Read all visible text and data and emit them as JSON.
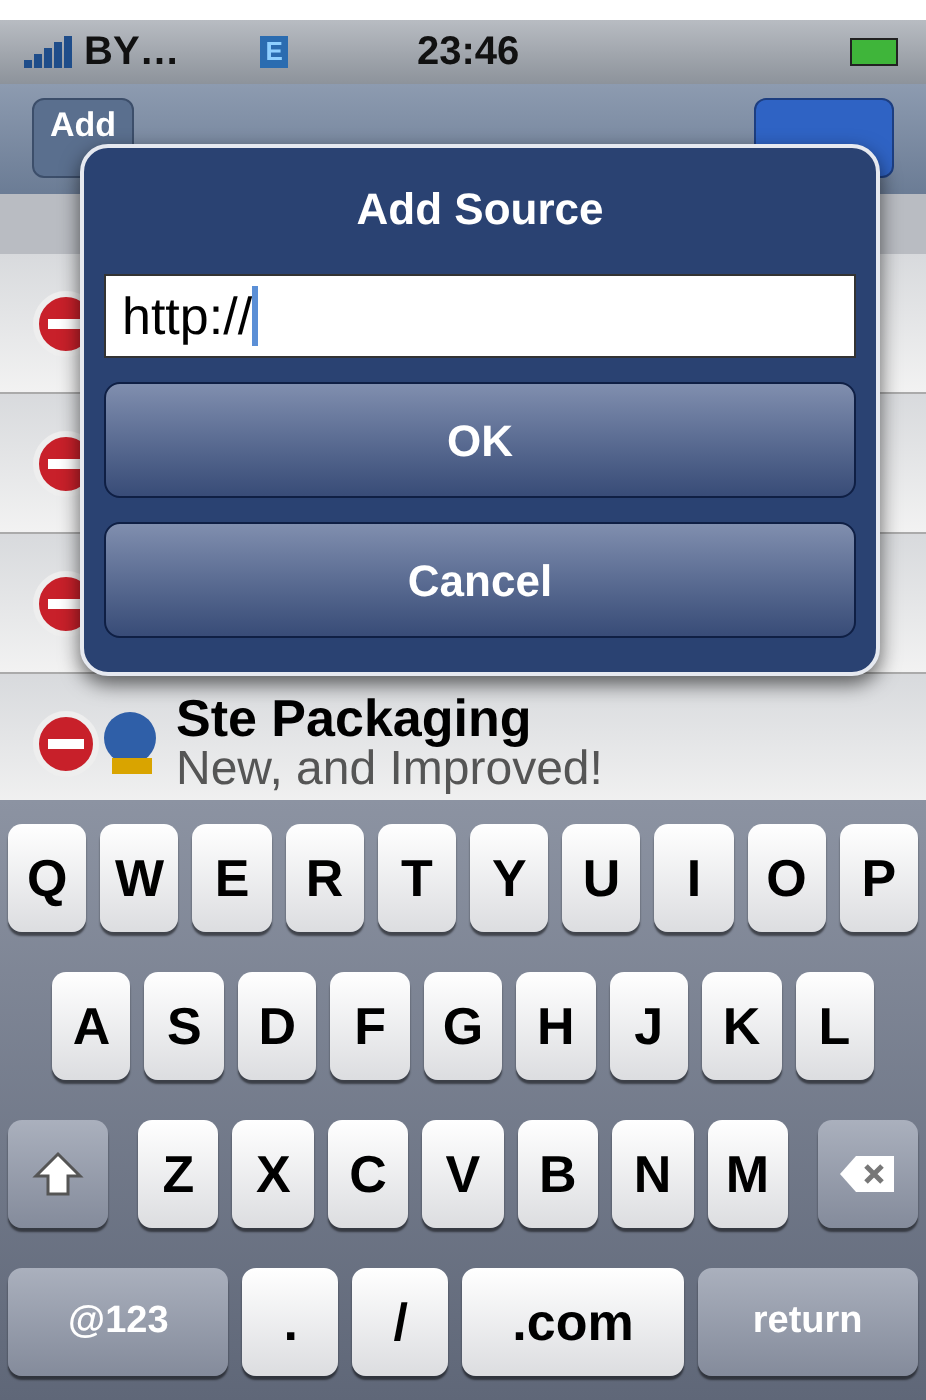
{
  "status_bar": {
    "carrier": "BY…",
    "network": "E",
    "time": "23:46"
  },
  "nav_bar": {
    "left_button": "Add"
  },
  "sources": [
    {
      "deletable": true
    },
    {
      "deletable": true
    },
    {
      "deletable": true
    },
    {
      "deletable": true,
      "name": "Ste Packaging",
      "subtitle": "New, and Improved!"
    }
  ],
  "dialog": {
    "title": "Add Source",
    "field_value": "http://",
    "buttons": [
      "OK",
      "Cancel"
    ]
  },
  "keyboard": {
    "rows": [
      {
        "keys": [
          {
            "kind": "char",
            "label": "Q"
          },
          {
            "kind": "char",
            "label": "W"
          },
          {
            "kind": "char",
            "label": "E"
          },
          {
            "kind": "char",
            "label": "R"
          },
          {
            "kind": "char",
            "label": "T"
          },
          {
            "kind": "char",
            "label": "Y"
          },
          {
            "kind": "char",
            "label": "U"
          },
          {
            "kind": "char",
            "label": "I"
          },
          {
            "kind": "char",
            "label": "O"
          },
          {
            "kind": "char",
            "label": "P"
          }
        ]
      },
      {
        "keys": [
          {
            "kind": "char",
            "label": "A"
          },
          {
            "kind": "char",
            "label": "S"
          },
          {
            "kind": "char",
            "label": "D"
          },
          {
            "kind": "char",
            "label": "F"
          },
          {
            "kind": "char",
            "label": "G"
          },
          {
            "kind": "char",
            "label": "H"
          },
          {
            "kind": "char",
            "label": "J"
          },
          {
            "kind": "char",
            "label": "K"
          },
          {
            "kind": "char",
            "label": "L"
          }
        ]
      },
      {
        "keys": [
          {
            "kind": "shift"
          },
          {
            "kind": "char",
            "label": "Z"
          },
          {
            "kind": "char",
            "label": "X"
          },
          {
            "kind": "char",
            "label": "C"
          },
          {
            "kind": "char",
            "label": "V"
          },
          {
            "kind": "char",
            "label": "B"
          },
          {
            "kind": "char",
            "label": "N"
          },
          {
            "kind": "char",
            "label": "M"
          },
          {
            "kind": "backspace"
          }
        ]
      },
      {
        "keys": [
          {
            "kind": "mode",
            "label": "@123"
          },
          {
            "kind": "char",
            "label": "."
          },
          {
            "kind": "char",
            "label": "/"
          },
          {
            "kind": "char",
            "label": ".com"
          },
          {
            "kind": "mode",
            "label": "return"
          }
        ]
      }
    ]
  }
}
